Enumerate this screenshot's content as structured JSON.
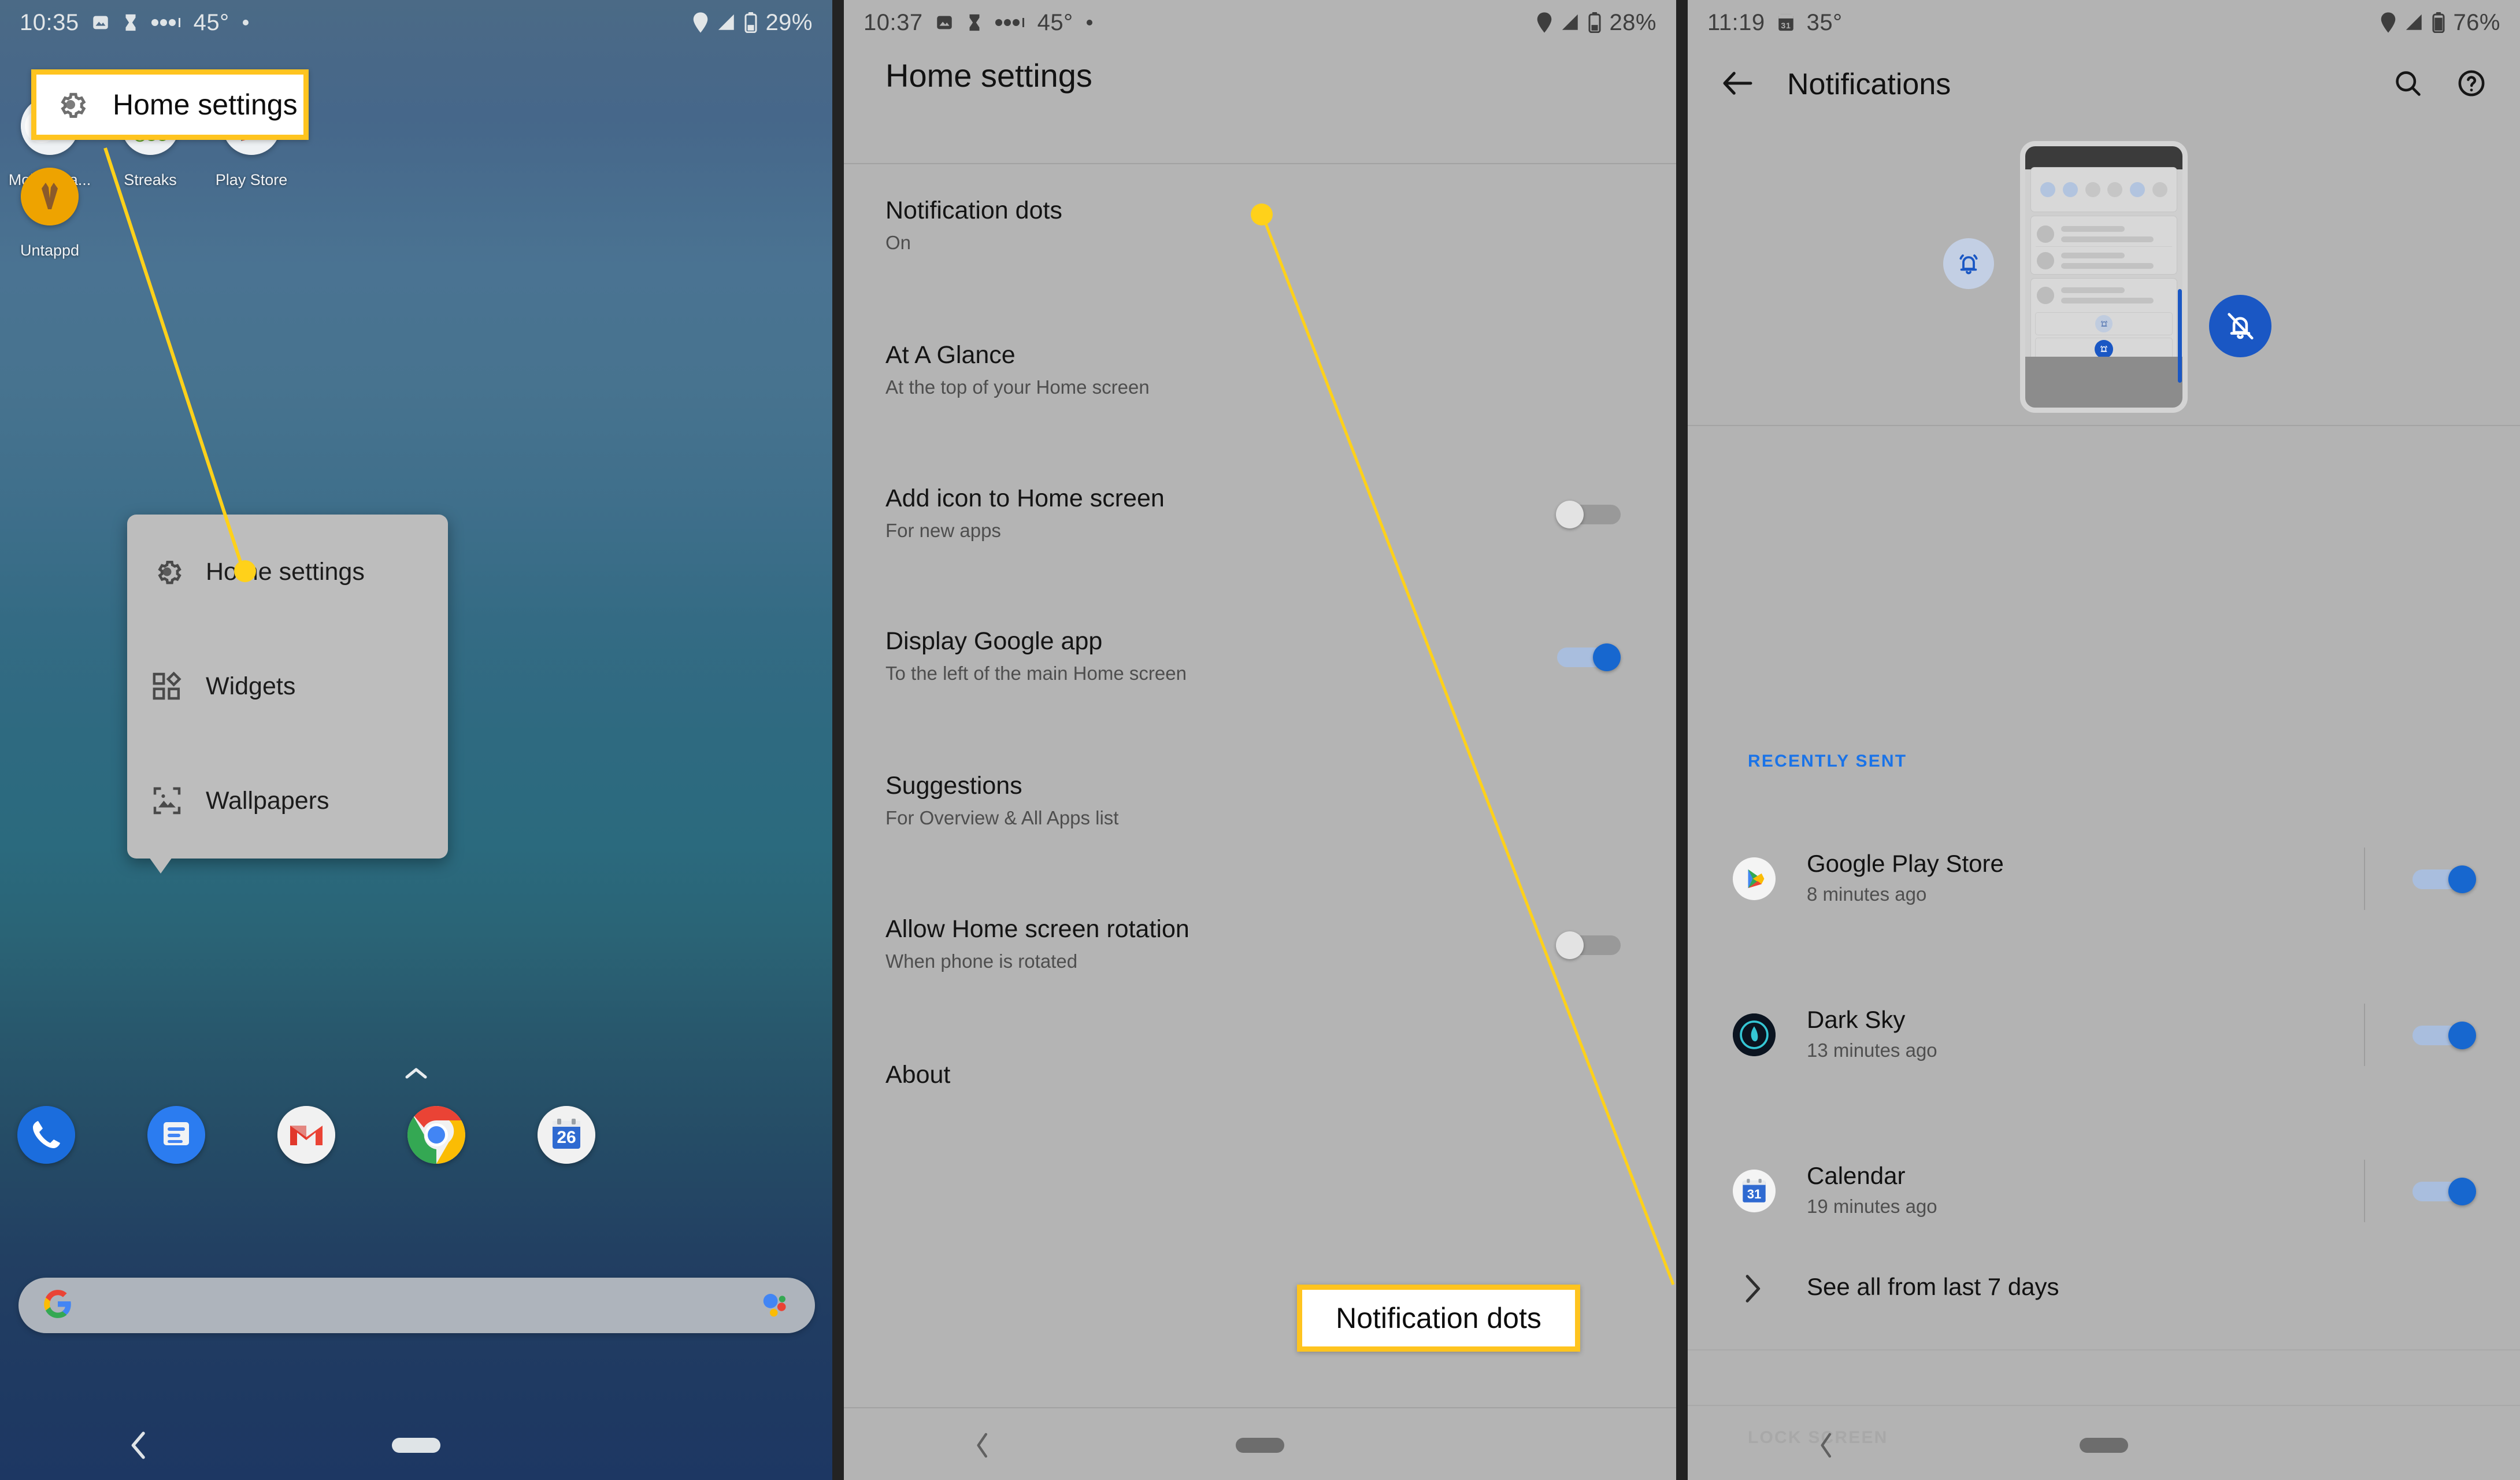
{
  "accent": {
    "highlight": "#ffc41f",
    "blue": "#1a73e8",
    "toggle_on": "#1767cf"
  },
  "panel1": {
    "status_bar": {
      "time": "10:35",
      "temperature": "45°",
      "battery": "29%",
      "icons": [
        "photo-icon",
        "hourglass-icon",
        "dots-icon",
        "dot-icon",
        "location-icon",
        "signal-icon",
        "battery-icon"
      ]
    },
    "callout": {
      "label": "Home settings",
      "icon": "gear-icon"
    },
    "apps": [
      {
        "label": "Mobile Pa...",
        "icon": "mobile-pay-icon"
      },
      {
        "label": "Streaks",
        "icon": "streaks-icon"
      },
      {
        "label": "Play Store",
        "icon": "play-store-icon"
      },
      {
        "label": "Untappd",
        "icon": "untappd-icon"
      }
    ],
    "popup_menu": {
      "items": [
        {
          "label": "Home settings",
          "icon": "gear-icon"
        },
        {
          "label": "Widgets",
          "icon": "widgets-icon"
        },
        {
          "label": "Wallpapers",
          "icon": "wallpaper-icon"
        }
      ]
    },
    "dock": [
      {
        "name": "Phone",
        "icon": "phone-icon"
      },
      {
        "name": "Messages",
        "icon": "messages-icon"
      },
      {
        "name": "Gmail",
        "icon": "gmail-icon"
      },
      {
        "name": "Chrome",
        "icon": "chrome-icon"
      },
      {
        "name": "Calendar",
        "icon": "calendar-icon",
        "day": "26"
      }
    ],
    "search_bar": {
      "leading_icon": "google-g-icon",
      "trailing_icon": "assistant-icon"
    },
    "nav_bar": {
      "back": "back-chevron-icon",
      "home": "home-pill-icon"
    }
  },
  "panel2": {
    "status_bar": {
      "time": "10:37",
      "temperature": "45°",
      "battery": "28%"
    },
    "title": "Home settings",
    "settings": [
      {
        "title": "Notification dots",
        "subtitle": "On",
        "toggle": null
      },
      {
        "title": "At A Glance",
        "subtitle": "At the top of your Home screen",
        "toggle": null
      },
      {
        "title": "Add icon to Home screen",
        "subtitle": "For new apps",
        "toggle": "off"
      },
      {
        "title": "Display Google app",
        "subtitle": "To the left of the main Home screen",
        "toggle": "on"
      },
      {
        "title": "Suggestions",
        "subtitle": "For Overview & All Apps list",
        "toggle": null
      },
      {
        "title": "Allow Home screen rotation",
        "subtitle": "When phone is rotated",
        "toggle": "off"
      },
      {
        "title": "About",
        "subtitle": "",
        "toggle": null
      }
    ],
    "callout": {
      "label": "Notification dots"
    },
    "nav_bar": {
      "back": "back-chevron-icon",
      "home": "home-pill-icon"
    }
  },
  "panel3": {
    "status_bar": {
      "time": "11:19",
      "temperature": "35°",
      "battery": "76%",
      "calendar_day": "31"
    },
    "app_bar": {
      "back": "back-arrow-icon",
      "title": "Notifications",
      "search": "search-icon",
      "help": "help-icon"
    },
    "hero": {
      "bell_icon": "bell-ring-icon",
      "bell_off_icon": "bell-off-icon"
    },
    "section_label": "RECENTLY SENT",
    "recently_sent": [
      {
        "app": "Google Play Store",
        "time": "8 minutes ago",
        "icon": "play-store-icon",
        "toggle": "on"
      },
      {
        "app": "Dark Sky",
        "time": "13 minutes ago",
        "icon": "dark-sky-icon",
        "toggle": "on"
      },
      {
        "app": "Calendar",
        "time": "19 minutes ago",
        "icon": "calendar-icon",
        "day": "31",
        "toggle": "on"
      }
    ],
    "see_all": {
      "label": "See all from last 7 days",
      "icon": "chevron-right-icon"
    },
    "lock_screen_label": "LOCK SCREEN",
    "nav_bar": {
      "back": "back-chevron-icon",
      "home": "home-pill-icon"
    }
  }
}
